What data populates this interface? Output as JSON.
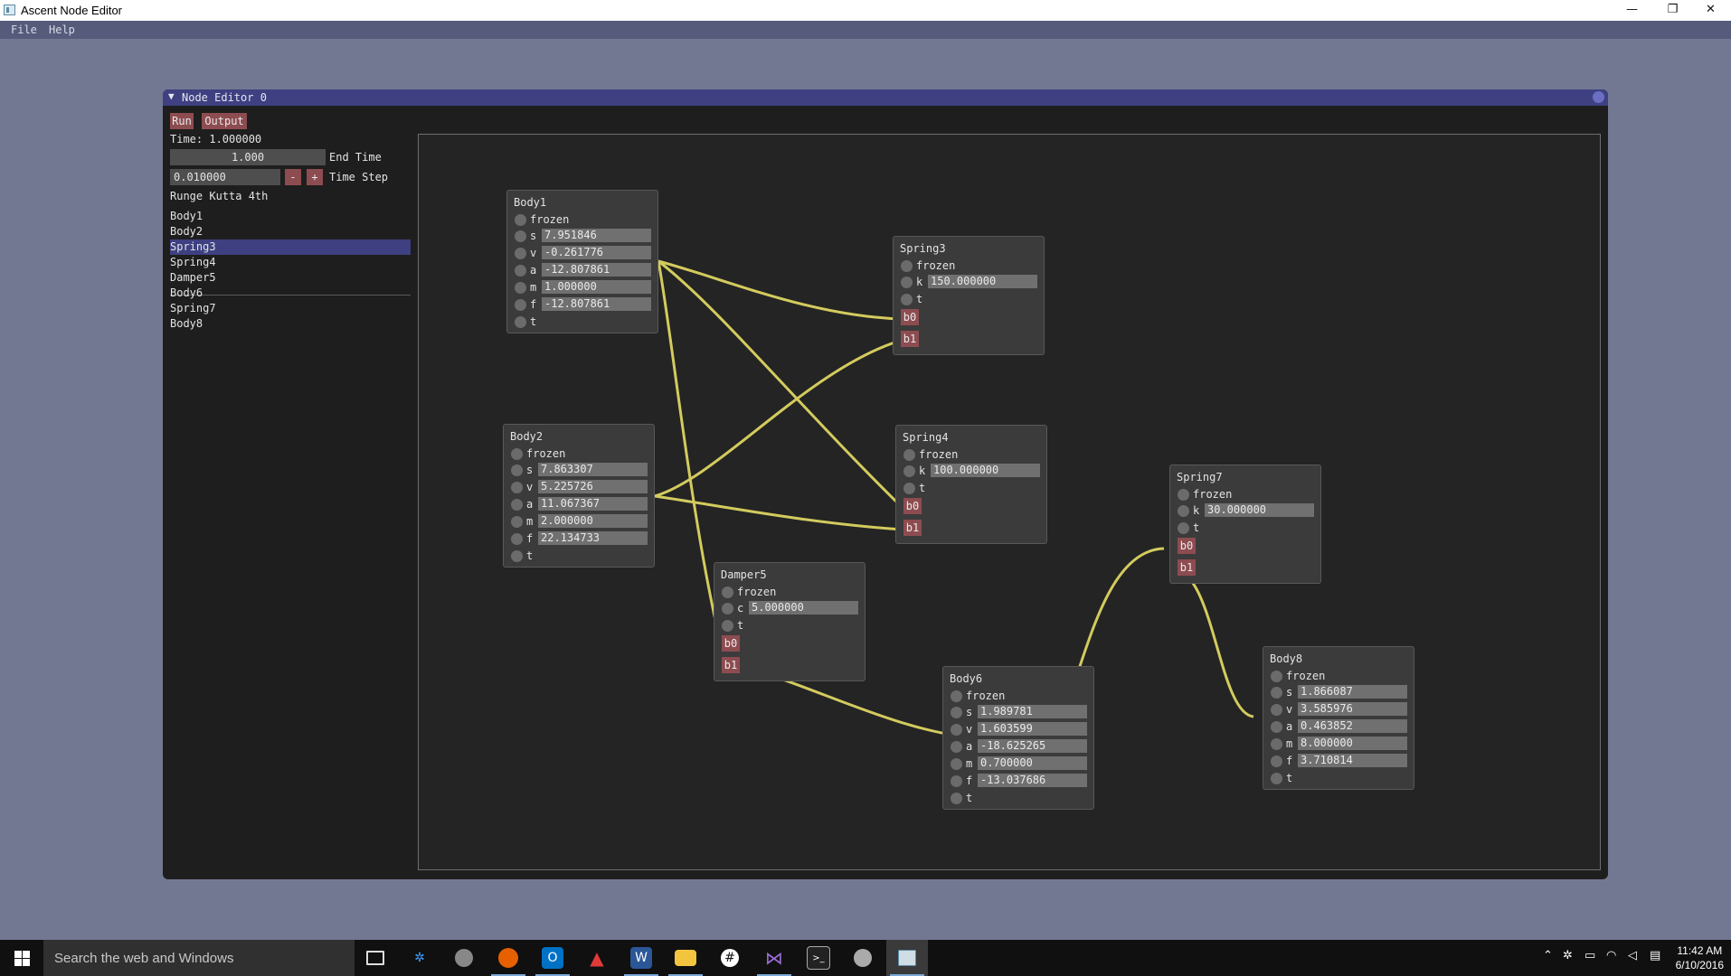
{
  "window": {
    "title": "Ascent Node Editor",
    "controls": {
      "minimize": "—",
      "restore": "❐",
      "close": "✕"
    }
  },
  "menubar": {
    "items": [
      "File",
      "Help"
    ]
  },
  "editor": {
    "title": "Node Editor 0",
    "collapse_glyph": "▼",
    "run_label": "Run",
    "output_label": "Output",
    "time_text": "Time: 1.000000",
    "end_time_value": "1.000",
    "end_time_label": "End Time",
    "time_step_value": "0.010000",
    "minus_label": "-",
    "plus_label": "+",
    "time_step_label": "Time Step",
    "integrator": "Runge Kutta 4th",
    "list": [
      "Body1",
      "Body2",
      "Spring3",
      "Spring4",
      "Damper5",
      "Body6",
      "Spring7",
      "Body8"
    ],
    "selected": "Spring3"
  },
  "nodes": {
    "body1": {
      "title": "Body1",
      "frozen": "frozen",
      "s_label": "s",
      "s": "7.951846",
      "v_label": "v",
      "v": "-0.261776",
      "a_label": "a",
      "a": "-12.807861",
      "m_label": "m",
      "m": "1.000000",
      "f_label": "f",
      "f": "-12.807861",
      "t_label": "t"
    },
    "body2": {
      "title": "Body2",
      "frozen": "frozen",
      "s_label": "s",
      "s": "7.863307",
      "v_label": "v",
      "v": "5.225726",
      "a_label": "a",
      "a": "11.067367",
      "m_label": "m",
      "m": "2.000000",
      "f_label": "f",
      "f": "22.134733",
      "t_label": "t"
    },
    "spring3": {
      "title": "Spring3",
      "frozen": "frozen",
      "k_label": "k",
      "k": "150.000000",
      "t_label": "t",
      "b0": "b0",
      "b1": "b1"
    },
    "spring4": {
      "title": "Spring4",
      "frozen": "frozen",
      "k_label": "k",
      "k": "100.000000",
      "t_label": "t",
      "b0": "b0",
      "b1": "b1"
    },
    "damper5": {
      "title": "Damper5",
      "frozen": "frozen",
      "c_label": "c",
      "c": "5.000000",
      "t_label": "t",
      "b0": "b0",
      "b1": "b1"
    },
    "body6": {
      "title": "Body6",
      "frozen": "frozen",
      "s_label": "s",
      "s": "1.989781",
      "v_label": "v",
      "v": "1.603599",
      "a_label": "a",
      "a": "-18.625265",
      "m_label": "m",
      "m": "0.700000",
      "f_label": "f",
      "f": "-13.037686",
      "t_label": "t"
    },
    "spring7": {
      "title": "Spring7",
      "frozen": "frozen",
      "k_label": "k",
      "k": "30.000000",
      "t_label": "t",
      "b0": "b0",
      "b1": "b1"
    },
    "body8": {
      "title": "Body8",
      "frozen": "frozen",
      "s_label": "s",
      "s": "1.866087",
      "v_label": "v",
      "v": "3.585976",
      "a_label": "a",
      "a": "0.463852",
      "m_label": "m",
      "m": "8.000000",
      "f_label": "f",
      "f": "3.710814",
      "t_label": "t"
    }
  },
  "links": [
    {
      "from": "Body1",
      "to": "Spring3.b0"
    },
    {
      "from": "Body1",
      "to": "Spring4.b0"
    },
    {
      "from": "Body1",
      "to": "Damper5.b0"
    },
    {
      "from": "Body2",
      "to": "Spring3.b1"
    },
    {
      "from": "Body2",
      "to": "Spring4.b1"
    },
    {
      "from": "Damper5.b1",
      "to": "Body6"
    },
    {
      "from": "Body6",
      "to": "Spring7.b0"
    },
    {
      "from": "Spring7.b1",
      "to": "Body8"
    }
  ],
  "colors": {
    "link": "#d3cb5e",
    "port": "#8d4c50",
    "title_bar": "#3e4082",
    "desktop": "#737892"
  },
  "taskbar": {
    "search_placeholder": "Search the web and Windows",
    "time": "11:42 AM",
    "date": "6/10/2016",
    "apps": [
      "task-view-icon",
      "network-tool-icon",
      "chrome-like-icon",
      "firefox-icon",
      "outlook-icon",
      "prism-icon",
      "word-icon",
      "file-explorer-icon",
      "slack-icon",
      "visual-studio-icon",
      "terminal-icon",
      "paint-icon",
      "node-editor-icon"
    ]
  }
}
